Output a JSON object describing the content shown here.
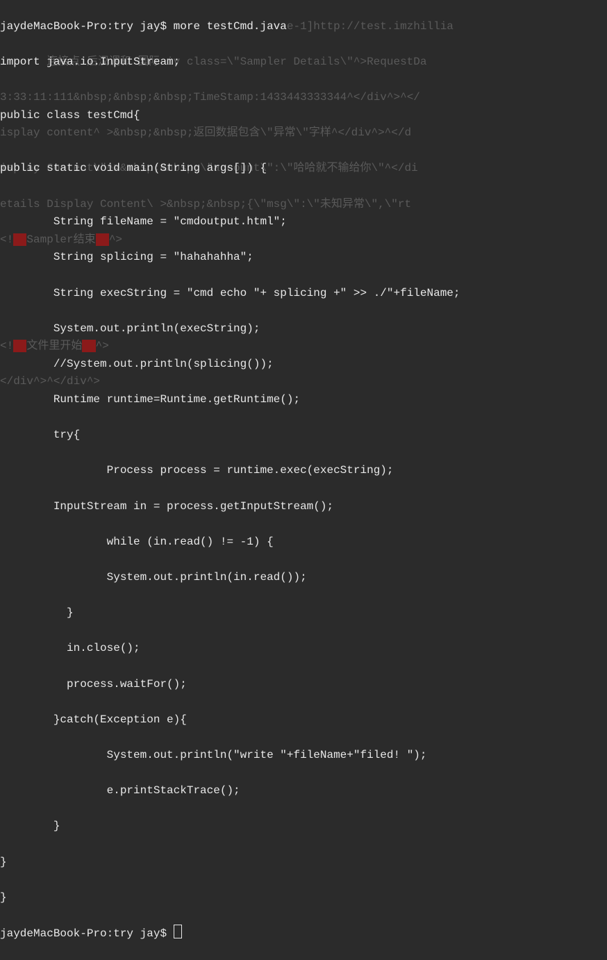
{
  "ghost": {
    "l0": "jaydeMacBook-Pro:try jay$ more testCmd.javae-1]http://test.imzhillia",
    "l1": "import 连接点 后汉调和 国际 iv class=\\\"Sampler Details\\\"^>RequestDa",
    "l2": "3:33:11:111&nbsp;&nbsp;&nbsp;TimeStamp:1433443333344^</div^>^</",
    "l3": "isplay content^ >&nbsp;&nbsp;返回数据包含\\\"异常\\\"字样^</div^>^</d",
    "l4": "isplay Content\\\"^>&nbsp;&nbsp;\\\"account\\\":\\\"哈哈就不输给你\\\"^</di",
    "l5": "etails Display Content\\ >&nbsp;&nbsp;{\\\"msg\\\":\\\"未知异常\\\",\\\"rt",
    "l6a": "<!",
    "l6b": "Sampler结束",
    "l6c": "^>",
    "l9a": "<!",
    "l9b": "文件里开始",
    "l9c": "^>",
    "l10": "</div^>^</div^>"
  },
  "code": {
    "l0": "jaydeMacBook-Pro:try jay$ more testCmd.java",
    "l1": "import java.io.InputStream;",
    "l2": "",
    "l3": "public class testCmd{",
    "l4": "",
    "l5": "public static void main(String args[]) {",
    "l6": "",
    "l7": "        String fileName = \"cmdoutput.html\";",
    "l8": "        String splicing = \"hahahahha\";",
    "l9": "        String execString = \"cmd echo \"+ splicing +\" >> ./\"+fileName;",
    "l10": "        System.out.println(execString);",
    "l11": "        //System.out.println(splicing());",
    "l12": "        Runtime runtime=Runtime.getRuntime();",
    "l13": "        try{",
    "l14": "                Process process = runtime.exec(execString);",
    "l15": "        InputStream in = process.getInputStream();",
    "l16": "                while (in.read() != -1) {",
    "l17": "                System.out.println(in.read());",
    "l18": "          }",
    "l19": "          in.close();",
    "l20": "          process.waitFor();",
    "l21": "        }catch(Exception e){",
    "l22": "                System.out.println(\"write \"+fileName+\"filed! \");",
    "l23": "                e.printStackTrace();",
    "l24": "        }",
    "l25": "}",
    "l26": "}",
    "l27": "jaydeMacBook-Pro:try jay$ "
  }
}
